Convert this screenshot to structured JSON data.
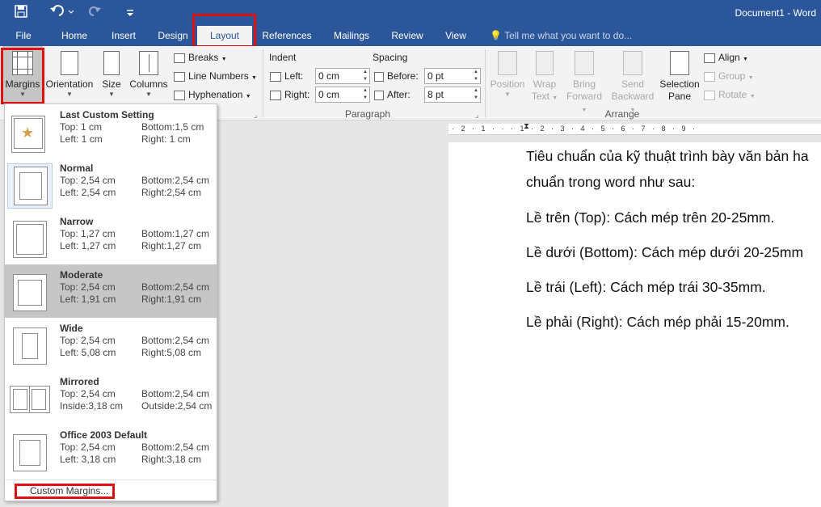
{
  "app": {
    "doc_title": "Document1 - Word"
  },
  "tabs": [
    "File",
    "Home",
    "Insert",
    "Design",
    "Layout",
    "References",
    "Mailings",
    "Review",
    "View"
  ],
  "tell_me": "Tell me what you want to do...",
  "ribbon": {
    "margins": "Margins",
    "orientation": "Orientation",
    "size": "Size",
    "columns": "Columns",
    "breaks": "Breaks",
    "line_numbers": "Line Numbers",
    "hyphenation": "Hyphenation",
    "indent_label": "Indent",
    "spacing_label": "Spacing",
    "left_label": "Left:",
    "right_label": "Right:",
    "before_label": "Before:",
    "after_label": "After:",
    "indent_left": "0 cm",
    "indent_right": "0 cm",
    "spacing_before": "0 pt",
    "spacing_after": "8 pt",
    "paragraph_group": "Paragraph",
    "position": [
      "Position",
      ""
    ],
    "wrap_text": [
      "Wrap",
      "Text"
    ],
    "bring_forward": [
      "Bring",
      "Forward"
    ],
    "send_backward": [
      "Send",
      "Backward"
    ],
    "selection_pane": [
      "Selection",
      "Pane"
    ],
    "align": "Align",
    "group": "Group",
    "rotate": "Rotate",
    "arrange_group": "Arrange"
  },
  "ruler": "· 2 · 1 · · · 1 · 2 · 3 · 4 · 5 · 6 · 7 · 8 · 9 ·",
  "document": {
    "lines": [
      "Tiêu chuẩn của kỹ thuật trình bày văn bản ha",
      "chuẩn trong word như sau:",
      "Lề trên (Top): Cách mép trên 20-25mm.",
      "Lề dưới (Bottom): Cách mép dưới 20-25mm",
      "Lề trái (Left): Cách mép trái 30-35mm.",
      "Lề phải (Right): Cách mép phải 15-20mm."
    ]
  },
  "margins_menu": {
    "options": [
      {
        "name": "Last Custom Setting",
        "top": "Top:      1 cm",
        "left": "Left:      1 cm",
        "bottom": "Bottom:1,5 cm",
        "right": "Right:    1 cm"
      },
      {
        "name": "Normal",
        "top": "Top:  2,54 cm",
        "left": "Left:  2,54 cm",
        "bottom": "Bottom:2,54 cm",
        "right": "Right:2,54 cm"
      },
      {
        "name": "Narrow",
        "top": "Top:  1,27 cm",
        "left": "Left:  1,27 cm",
        "bottom": "Bottom:1,27 cm",
        "right": "Right:1,27 cm"
      },
      {
        "name": "Moderate",
        "top": "Top:  2,54 cm",
        "left": "Left:  1,91 cm",
        "bottom": "Bottom:2,54 cm",
        "right": "Right:1,91 cm"
      },
      {
        "name": "Wide",
        "top": "Top:  2,54 cm",
        "left": "Left:  5,08 cm",
        "bottom": "Bottom:2,54 cm",
        "right": "Right:5,08 cm"
      },
      {
        "name": "Mirrored",
        "top": "Top:  2,54 cm",
        "left": "Inside:3,18 cm",
        "bottom": "Bottom:2,54 cm",
        "right": "Outside:2,54 cm"
      },
      {
        "name": "Office 2003 Default",
        "top": "Top:  2,54 cm",
        "left": "Left:  3,18 cm",
        "bottom": "Bottom:2,54 cm",
        "right": "Right:3,18 cm"
      }
    ],
    "custom_margins": "Custom Margins..."
  }
}
